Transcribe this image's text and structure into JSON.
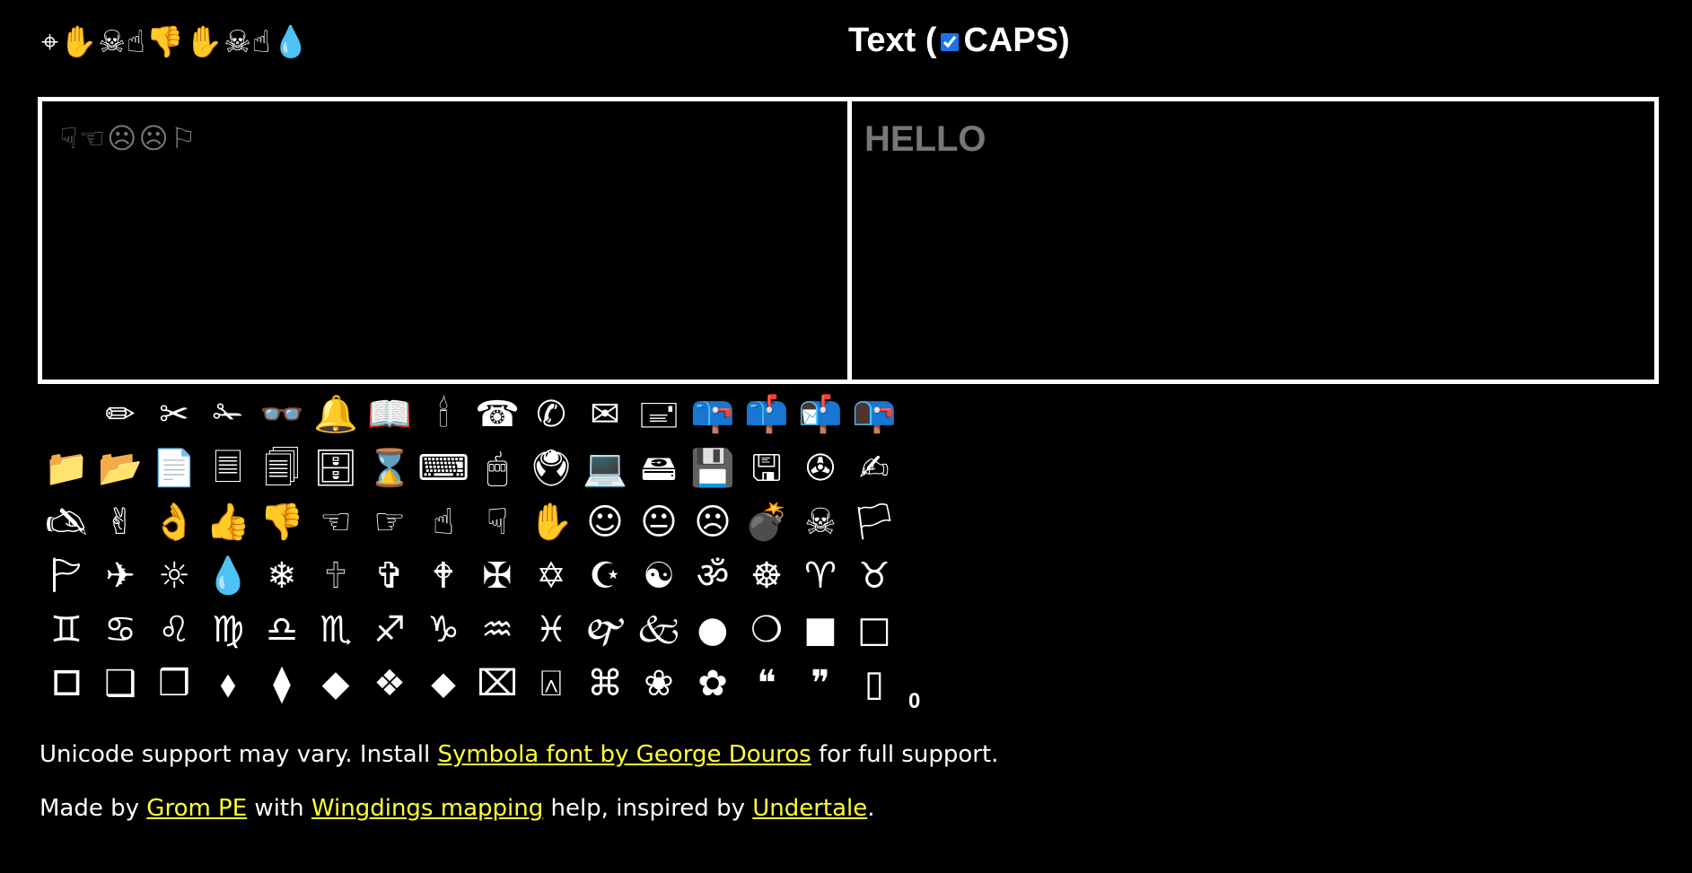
{
  "header": {
    "wingdings_title": "⌖✋☠☝👎✋☠☝💧",
    "text_label_open": "Text (",
    "caps_label": "CAPS)",
    "caps_checked": true
  },
  "input_panel": {
    "wingdings_text": "☟☜☹☹⚐"
  },
  "output_panel": {
    "text": "HELLO"
  },
  "palette": {
    "rows": [
      [
        "",
        "✏",
        "✂",
        "✁",
        "👓",
        "🔔",
        "📖",
        "🕯",
        "☎",
        "✆",
        "✉",
        "🖃",
        "📪",
        "📫",
        "📬",
        "📭"
      ],
      [
        "📁",
        "📂",
        "📄",
        "🗏",
        "🗐",
        "🗄",
        "⌛",
        "⌨",
        "🖱",
        "🖲",
        "💻",
        "🖴",
        "💾",
        "🖫",
        "✇",
        "✍"
      ],
      [
        "🖎",
        "✌",
        "👌",
        "👍",
        "👎",
        "☜",
        "☞",
        "☝",
        "☟",
        "✋",
        "☺",
        "😐",
        "☹",
        "💣",
        "☠",
        "🏳"
      ],
      [
        "🏱",
        "✈",
        "☼",
        "💧",
        "❄",
        "🕆",
        "✞",
        "🕈",
        "✠",
        "✡",
        "☪",
        "☯",
        "ॐ",
        "☸",
        "♈",
        "♉"
      ],
      [
        "♊",
        "♋",
        "♌",
        "♍",
        "♎",
        "♏",
        "♐",
        "♑",
        "♒",
        "♓",
        "🙰",
        "🙵",
        "●",
        "❍",
        "■",
        "□"
      ],
      [
        "🞐",
        "❑",
        "❒",
        "⬧",
        "⧫",
        "◆",
        "❖",
        "⬥",
        "⌧",
        "⍓",
        "⌘",
        "❀",
        "✿",
        "❝",
        "❞",
        "▯"
      ]
    ],
    "counter": "0"
  },
  "footer": {
    "line1_prefix": "Unicode support may vary. Install ",
    "line1_link": "Symbola font by George Douros",
    "line1_suffix": " for full support.",
    "line2_prefix": "Made by ",
    "line2_link1": "Grom PE",
    "line2_mid1": " with ",
    "line2_link2": "Wingdings mapping",
    "line2_mid2": " help, inspired by ",
    "line2_link3": "Undertale",
    "line2_suffix": "."
  },
  "colors": {
    "background": "#000000",
    "foreground": "#ffffff",
    "muted_text": "#777777",
    "link": "#ffff33",
    "checkbox": "#1a73e8"
  }
}
